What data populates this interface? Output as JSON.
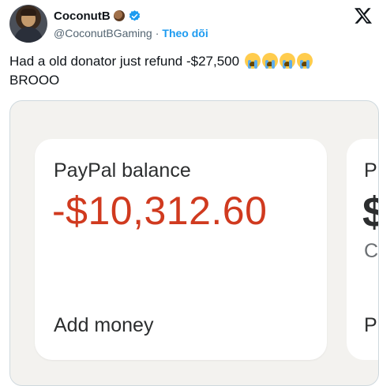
{
  "author": {
    "display_name": "CoconutB",
    "handle": "@CoconutBGaming",
    "separator": "·",
    "follow_label": "Theo dõi"
  },
  "tweet": {
    "text": "Had a old donator just refund -$27,500",
    "continuation": "BROOO",
    "emoji_name": "loudly-crying-face",
    "emoji_count": 4
  },
  "media": {
    "card": {
      "title": "PayPal balance",
      "amount": "-$10,312.60",
      "action": "Add money"
    },
    "card_partial": {
      "title_initial": "P",
      "amount_initial": "$",
      "sub_initial": "C",
      "action_initial": "P"
    }
  },
  "colors": {
    "accent": "#1d9bf0",
    "negative_amount": "#d03a1f",
    "media_background": "#f3f2ef",
    "text_primary": "#0f1419",
    "text_secondary": "#536471"
  }
}
